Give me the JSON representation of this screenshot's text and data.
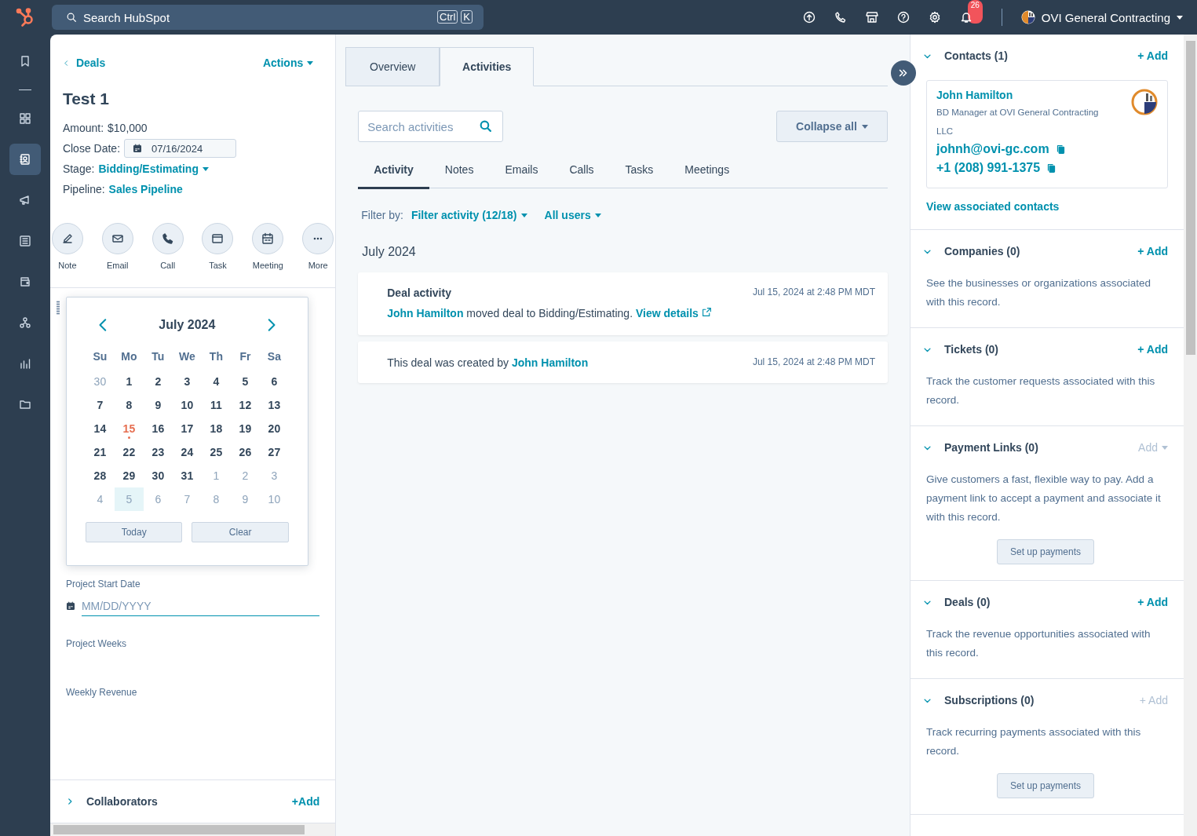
{
  "top_bar": {
    "search_placeholder": "Search HubSpot",
    "shortcut_keys": [
      "Ctrl",
      "K"
    ],
    "notification_count": "26",
    "account_name": "OVI General Contracting"
  },
  "rail": [
    {
      "selected": false
    },
    {
      "selected": false
    },
    {
      "selected": true
    },
    {
      "selected": false
    },
    {
      "selected": false
    },
    {
      "selected": false
    },
    {
      "selected": false
    },
    {
      "selected": false
    },
    {
      "selected": false
    }
  ],
  "record": {
    "back_label": "Deals",
    "actions_label": "Actions",
    "title": "Test 1",
    "properties": [
      {
        "label": "Amount:",
        "value": "$10,000",
        "kind": "text"
      },
      {
        "label": "Close Date:",
        "value": "07/16/2024",
        "kind": "date"
      },
      {
        "label": "Stage:",
        "value": "Bidding/Estimating",
        "kind": "dropdown"
      },
      {
        "label": "Pipeline:",
        "value": "Sales Pipeline",
        "kind": "link"
      }
    ],
    "quick_actions": [
      {
        "label": "Note"
      },
      {
        "label": "Email"
      },
      {
        "label": "Call"
      },
      {
        "label": "Task"
      },
      {
        "label": "Meeting"
      },
      {
        "label": "More"
      }
    ],
    "fields": [
      {
        "label": "Project Start Date",
        "placeholder": "MM/DD/YYYY",
        "kind": "date"
      },
      {
        "label": "Project Weeks",
        "kind": "empty"
      },
      {
        "label": "Weekly Revenue",
        "kind": "empty"
      }
    ],
    "collaborators": {
      "title": "Collaborators",
      "add_label": "+Add",
      "expanded": false
    }
  },
  "calendar": {
    "month": "July 2024",
    "weekdays": [
      "Su",
      "Mo",
      "Tu",
      "We",
      "Th",
      "Fr",
      "Sa"
    ],
    "weeks": [
      [
        {
          "d": "30",
          "kind": "outside",
          "selected": false
        },
        {
          "d": "1",
          "kind": "day",
          "selected": false
        },
        {
          "d": "2",
          "kind": "day",
          "selected": false
        },
        {
          "d": "3",
          "kind": "day",
          "selected": false
        },
        {
          "d": "4",
          "kind": "day",
          "selected": false
        },
        {
          "d": "5",
          "kind": "day",
          "selected": false
        },
        {
          "d": "6",
          "kind": "day",
          "selected": false
        }
      ],
      [
        {
          "d": "7",
          "kind": "day",
          "selected": false
        },
        {
          "d": "8",
          "kind": "day",
          "selected": false
        },
        {
          "d": "9",
          "kind": "day",
          "selected": false
        },
        {
          "d": "10",
          "kind": "day",
          "selected": false
        },
        {
          "d": "11",
          "kind": "day",
          "selected": false
        },
        {
          "d": "12",
          "kind": "day",
          "selected": false
        },
        {
          "d": "13",
          "kind": "day",
          "selected": false
        }
      ],
      [
        {
          "d": "14",
          "kind": "day",
          "selected": false
        },
        {
          "d": "15",
          "kind": "today",
          "selected": false
        },
        {
          "d": "16",
          "kind": "day",
          "selected": false
        },
        {
          "d": "17",
          "kind": "day",
          "selected": false
        },
        {
          "d": "18",
          "kind": "day",
          "selected": false
        },
        {
          "d": "19",
          "kind": "day",
          "selected": false
        },
        {
          "d": "20",
          "kind": "day",
          "selected": false
        }
      ],
      [
        {
          "d": "21",
          "kind": "day",
          "selected": false
        },
        {
          "d": "22",
          "kind": "day",
          "selected": false
        },
        {
          "d": "23",
          "kind": "day",
          "selected": false
        },
        {
          "d": "24",
          "kind": "day",
          "selected": false
        },
        {
          "d": "25",
          "kind": "day",
          "selected": false
        },
        {
          "d": "26",
          "kind": "day",
          "selected": false
        },
        {
          "d": "27",
          "kind": "day",
          "selected": false
        }
      ],
      [
        {
          "d": "28",
          "kind": "day",
          "selected": false
        },
        {
          "d": "29",
          "kind": "day",
          "selected": false
        },
        {
          "d": "30",
          "kind": "day",
          "selected": false
        },
        {
          "d": "31",
          "kind": "day",
          "selected": false
        },
        {
          "d": "1",
          "kind": "outside",
          "selected": false
        },
        {
          "d": "2",
          "kind": "outside",
          "selected": false
        },
        {
          "d": "3",
          "kind": "outside",
          "selected": false
        }
      ],
      [
        {
          "d": "4",
          "kind": "outside",
          "selected": false
        },
        {
          "d": "5",
          "kind": "outside",
          "selected": true
        },
        {
          "d": "6",
          "kind": "outside",
          "selected": false
        },
        {
          "d": "7",
          "kind": "outside",
          "selected": false
        },
        {
          "d": "8",
          "kind": "outside",
          "selected": false
        },
        {
          "d": "9",
          "kind": "outside",
          "selected": false
        },
        {
          "d": "10",
          "kind": "outside",
          "selected": false
        }
      ]
    ],
    "buttons": [
      "Today",
      "Clear"
    ]
  },
  "tabs": [
    {
      "label": "Overview",
      "selected": false
    },
    {
      "label": "Activities",
      "selected": true
    }
  ],
  "activities": {
    "search_placeholder": "Search activities",
    "collapse_label": "Collapse all",
    "subtabs": [
      {
        "label": "Activity",
        "selected": true
      },
      {
        "label": "Notes",
        "selected": false
      },
      {
        "label": "Emails",
        "selected": false
      },
      {
        "label": "Calls",
        "selected": false
      },
      {
        "label": "Tasks",
        "selected": false
      },
      {
        "label": "Meetings",
        "selected": false
      }
    ],
    "filter_label": "Filter by:",
    "filter_value": "Filter activity (12/18)",
    "users_value": "All users",
    "month": "July 2024",
    "items": [
      {
        "kind": "deal_activity",
        "title": "Deal activity",
        "time": "Jul 15, 2024 at 2:48 PM MDT",
        "actor": "John Hamilton",
        "text": "moved deal to Bidding/Estimating.",
        "link": "View details"
      },
      {
        "kind": "created",
        "time": "Jul 15, 2024 at 2:48 PM MDT",
        "text": "This deal was created by",
        "actor": "John Hamilton"
      }
    ]
  },
  "sidebar": {
    "contact": {
      "name": "John Hamilton",
      "job": "BD Manager at OVI General Contracting LLC",
      "email": "johnh@ovi-gc.com",
      "phone": "+1 (208) 991-1375"
    },
    "view_all": "View associated contacts",
    "sections": [
      {
        "title": "Contacts (1)",
        "add_label": "+ Add",
        "dropdown": false,
        "disabled": false,
        "expanded": true,
        "kind": "contacts"
      },
      {
        "title": "Companies (0)",
        "add_label": "+ Add",
        "dropdown": false,
        "disabled": false,
        "expanded": true,
        "kind": "text",
        "description": "See the businesses or organizations associated with this record."
      },
      {
        "title": "Tickets (0)",
        "add_label": "+ Add",
        "dropdown": false,
        "disabled": false,
        "expanded": true,
        "kind": "text",
        "description": "Track the customer requests associated with this record."
      },
      {
        "title": "Payment Links (0)",
        "add_label": "Add",
        "dropdown": true,
        "disabled": true,
        "expanded": true,
        "kind": "text",
        "description": "Give customers a fast, flexible way to pay. Add a payment link to accept a payment and associate it with this record.",
        "button": "Set up payments"
      },
      {
        "title": "Deals (0)",
        "add_label": "+ Add",
        "dropdown": false,
        "disabled": false,
        "expanded": true,
        "kind": "text",
        "description": "Track the revenue opportunities associated with this record."
      },
      {
        "title": "Subscriptions (0)",
        "add_label": "+ Add",
        "dropdown": false,
        "disabled": true,
        "expanded": true,
        "kind": "text",
        "description": "Track recurring payments associated with this record.",
        "button": "Set up payments"
      }
    ]
  }
}
